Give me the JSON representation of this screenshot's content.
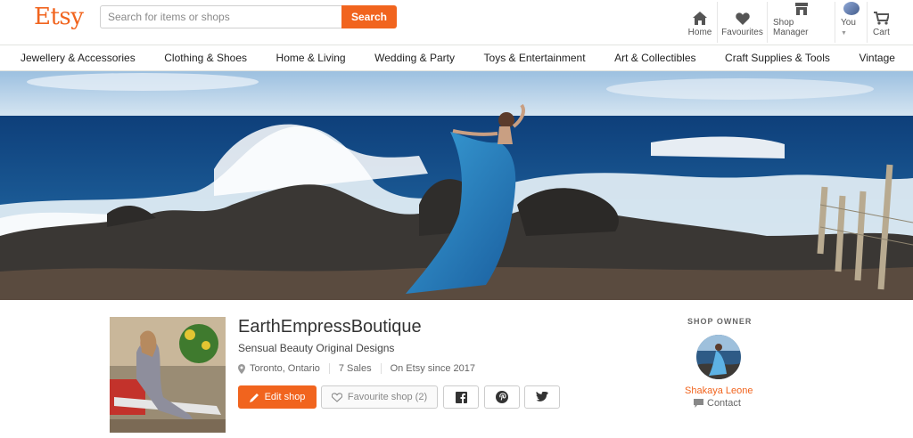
{
  "header": {
    "logo": "Etsy",
    "search": {
      "placeholder": "Search for items or shops",
      "button_label": "Search"
    },
    "nav": [
      {
        "label": "Home",
        "icon": "home-icon"
      },
      {
        "label": "Favourites",
        "icon": "heart-icon"
      },
      {
        "label": "Shop Manager",
        "icon": "shop-icon"
      },
      {
        "label": "You",
        "icon": "avatar"
      },
      {
        "label": "Cart",
        "icon": "cart-icon"
      }
    ]
  },
  "categories": [
    "Jewellery & Accessories",
    "Clothing & Shoes",
    "Home & Living",
    "Wedding & Party",
    "Toys & Entertainment",
    "Art & Collectibles",
    "Craft Supplies & Tools",
    "Vintage"
  ],
  "shop": {
    "name": "EarthEmpressBoutique",
    "tagline": "Sensual Beauty Original Designs",
    "location": "Toronto, Ontario",
    "sales": "7 Sales",
    "since": "On Etsy since 2017",
    "edit_label": "Edit shop",
    "favourite_label": "Favourite shop (2)"
  },
  "owner": {
    "section_label": "SHOP OWNER",
    "name": "Shakaya Leone",
    "contact_label": "Contact"
  },
  "colors": {
    "brand": "#f1641e",
    "text": "#222222",
    "border": "#e1e3df"
  }
}
